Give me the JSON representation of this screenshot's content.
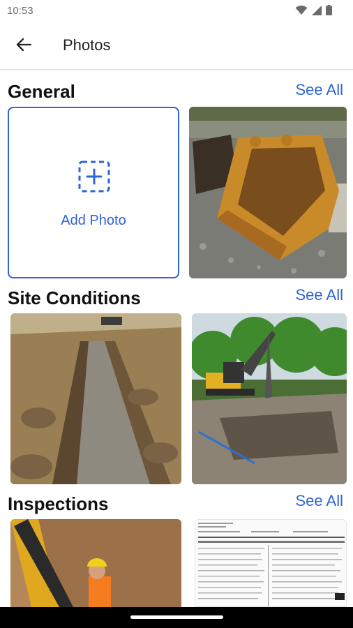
{
  "status": {
    "time": "10:53"
  },
  "app_bar": {
    "title": "Photos"
  },
  "sections": [
    {
      "title": "General",
      "see_all": "See All",
      "add_photo": "Add Photo"
    },
    {
      "title": "Site Conditions",
      "see_all": "See All"
    },
    {
      "title": "Inspections",
      "see_all": "See All"
    }
  ],
  "icons": {
    "back": "arrow-left-icon",
    "wifi": "wifi-icon",
    "signal": "signal-icon",
    "battery": "battery-icon",
    "add": "add-photo-icon"
  },
  "colors": {
    "accent": "#2f63d8"
  }
}
